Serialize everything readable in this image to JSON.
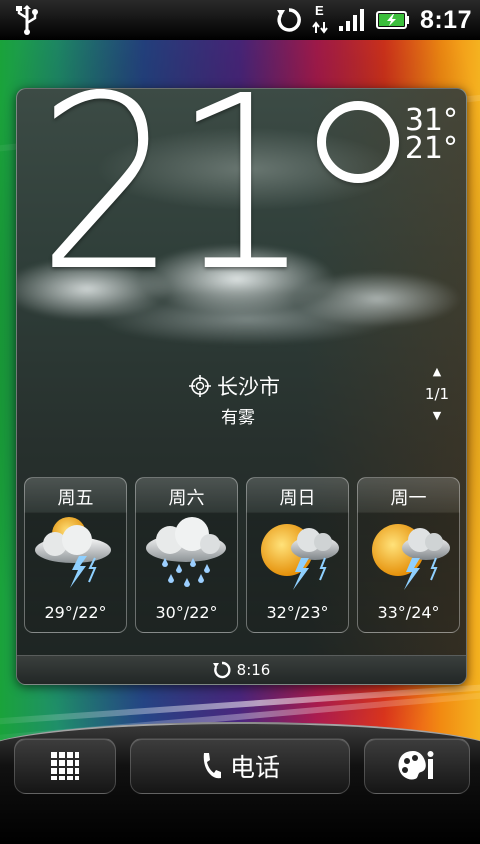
{
  "status_bar": {
    "time": "8:17",
    "network_letter": "E",
    "icons": [
      "usb-icon",
      "sync-icon",
      "data-arrows-icon",
      "signal-icon",
      "battery-charging-icon"
    ]
  },
  "weather": {
    "current_temp": "21",
    "high": "31°",
    "low": "21°",
    "city": "长沙市",
    "condition": "有雾",
    "page_indicator": "1/1",
    "last_updated": "8:16",
    "forecast": [
      {
        "day": "周五",
        "temps": "29°/22°",
        "icon": "thunderstorm-sun-icon"
      },
      {
        "day": "周六",
        "temps": "30°/22°",
        "icon": "rain-cloud-icon"
      },
      {
        "day": "周日",
        "temps": "32°/23°",
        "icon": "thunderstorm-sun-icon"
      },
      {
        "day": "周一",
        "temps": "33°/24°",
        "icon": "thunderstorm-sun-icon"
      }
    ]
  },
  "dock": {
    "phone_label": "电话",
    "icons": [
      "app-grid-icon",
      "phone-icon",
      "personalize-icon"
    ]
  },
  "colors": {
    "status_bar_bg": "#000000",
    "battery_fill": "#3cbf3c",
    "panel_bg": "#2f3e39",
    "sun": "#f5b41a",
    "lightning": "#8fd0ff"
  }
}
